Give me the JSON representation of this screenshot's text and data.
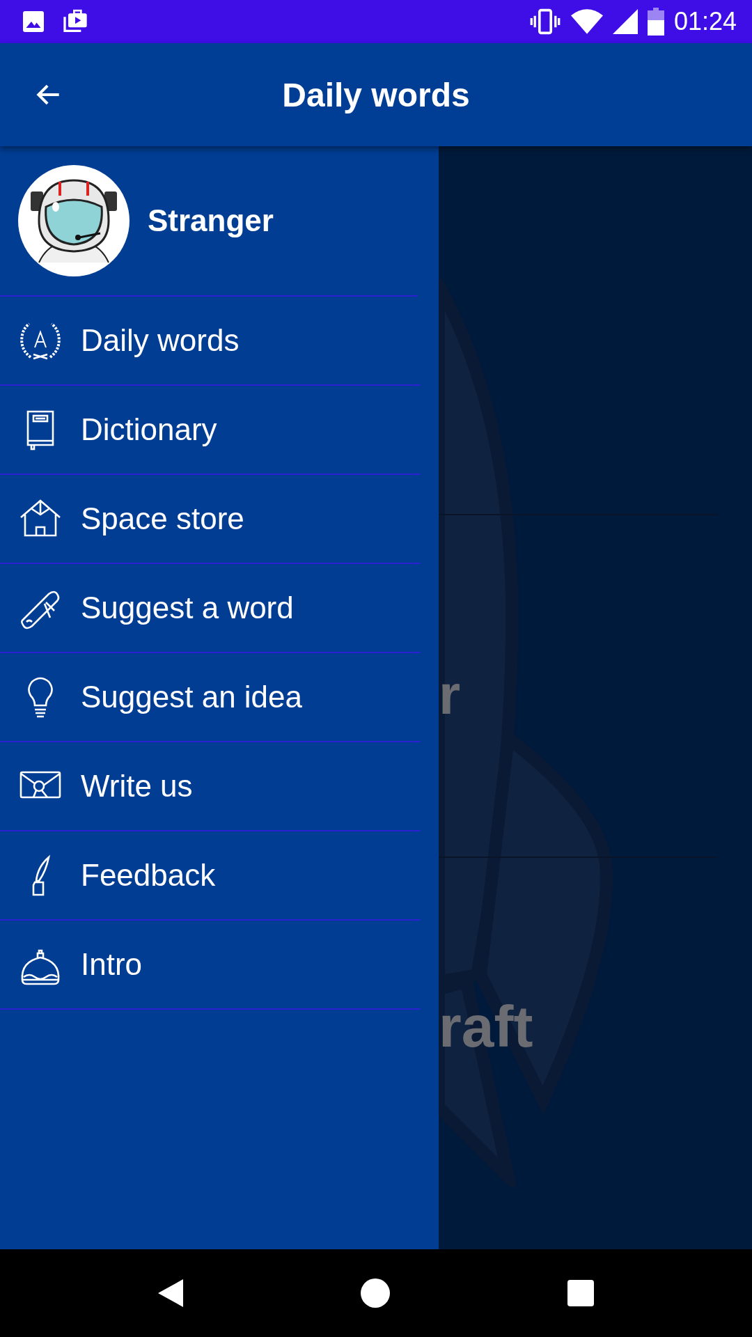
{
  "status_bar": {
    "time": "01:24"
  },
  "app_bar": {
    "title": "Daily words"
  },
  "drawer": {
    "user_name": "Stranger",
    "items": [
      {
        "label": "Daily words",
        "kind": "laurel"
      },
      {
        "label": "Dictionary",
        "kind": "book"
      },
      {
        "label": "Space store",
        "kind": "house"
      },
      {
        "label": "Suggest a word",
        "kind": "scroll"
      },
      {
        "label": "Suggest an idea",
        "kind": "bulb"
      },
      {
        "label": "Write us",
        "kind": "envelope"
      },
      {
        "label": "Feedback",
        "kind": "quill"
      },
      {
        "label": "Intro",
        "kind": "cloche"
      }
    ]
  },
  "background_texts": [
    "r",
    "raft"
  ]
}
